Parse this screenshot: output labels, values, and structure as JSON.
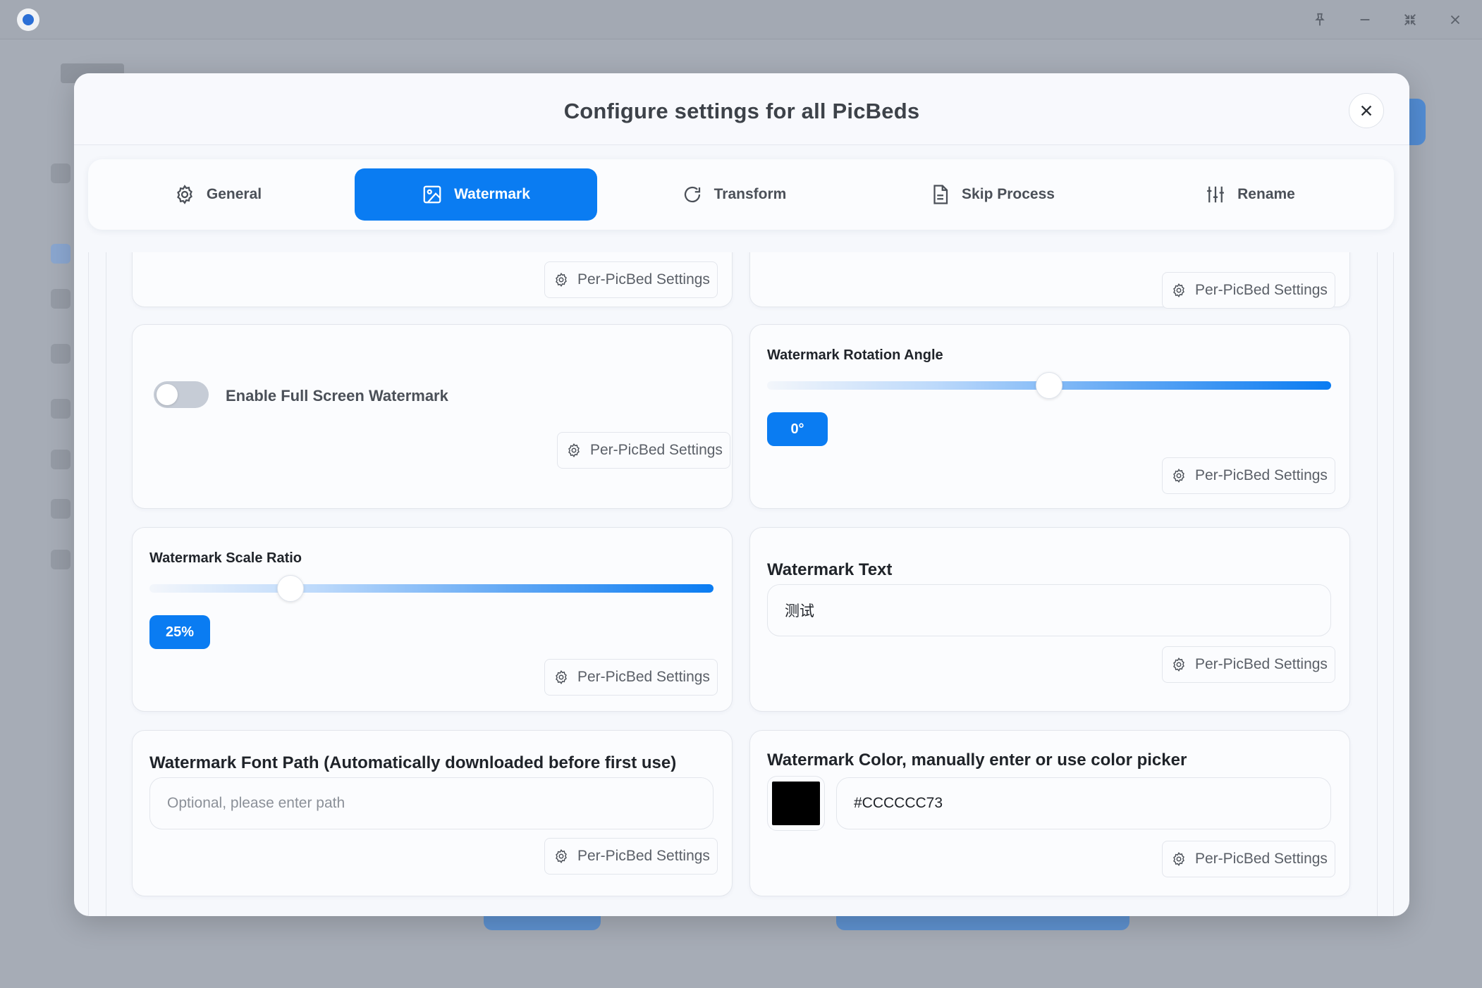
{
  "modal": {
    "title": "Configure settings for all PicBeds"
  },
  "tabs": [
    {
      "label": "General",
      "icon": "gear-icon",
      "active": false
    },
    {
      "label": "Watermark",
      "icon": "image-icon",
      "active": true
    },
    {
      "label": "Transform",
      "icon": "rotate-icon",
      "active": false
    },
    {
      "label": "Skip Process",
      "icon": "document-icon",
      "active": false
    },
    {
      "label": "Rename",
      "icon": "sliders-icon",
      "active": false
    }
  ],
  "per_picbed_label": "Per-PicBed Settings",
  "cards": {
    "fullscreen": {
      "label": "Enable Full Screen Watermark",
      "enabled": false
    },
    "rotation": {
      "label": "Watermark Rotation Angle",
      "value_text": "0°",
      "value_fraction": 0.5
    },
    "scale": {
      "label": "Watermark Scale Ratio",
      "value_text": "25%",
      "value_fraction": 0.25
    },
    "text": {
      "label": "Watermark Text",
      "value": "测试"
    },
    "font_path": {
      "label": "Watermark Font Path (Automatically downloaded before first use)",
      "placeholder": "Optional, please enter path",
      "value": ""
    },
    "color": {
      "label": "Watermark Color, manually enter or use color picker",
      "value": "#CCCCCC73",
      "swatch_color": "#000000"
    }
  },
  "colors": {
    "accent": "#0a7cf2",
    "background_overlay": "#a6acb6"
  }
}
